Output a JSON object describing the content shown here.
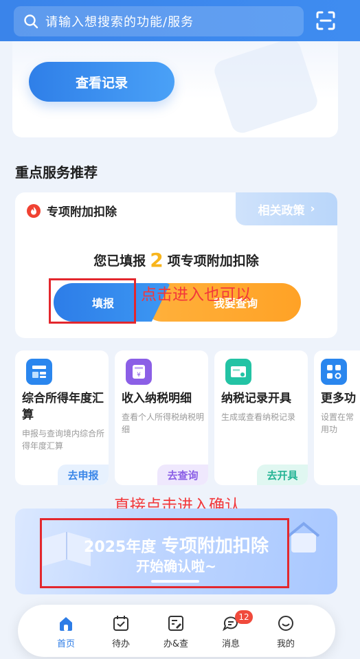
{
  "search": {
    "placeholder": "请输入想搜索的功能/服务"
  },
  "top_card": {
    "record_button": "查看记录"
  },
  "section_title": "重点服务推荐",
  "deduction": {
    "title": "专项附加扣除",
    "policy_button": "相关政策",
    "filled_prefix": "您已填报",
    "filled_count": "2",
    "filled_suffix": "项专项附加扣除",
    "fill_button": "填报",
    "query_button": "我要查询"
  },
  "annotations": {
    "note1": "点击进入也可以",
    "note2": "直接点击进入确认"
  },
  "services": [
    {
      "name": "综合所得年度汇算",
      "desc": "申报与查询境内综合所得年度汇算",
      "action": "去申报",
      "icon": "calculator-icon",
      "color": "#2a86ee",
      "action_bg": "#e7f1fe",
      "action_color": "#3a86e8"
    },
    {
      "name": "收入纳税明细",
      "desc": "查看个人所得税纳税明细",
      "action": "去查询",
      "icon": "document-yen-icon",
      "color": "#8b5fe6",
      "action_bg": "#efe8fd",
      "action_color": "#8b5fe6"
    },
    {
      "name": "纳税记录开具",
      "desc": "生成或查看纳税记录",
      "action": "去开具",
      "icon": "certificate-icon",
      "color": "#23c3a4",
      "action_bg": "#e0f7f1",
      "action_color": "#23b394"
    },
    {
      "name": "更多功",
      "desc": "设置在常用功",
      "icon": "grid-search-icon",
      "color": "#2a86ee"
    }
  ],
  "banner": {
    "year_text": "2025年度",
    "highlight": "专项附加扣除",
    "line2": "开始确认啦~"
  },
  "nav": [
    {
      "label": "首页",
      "icon": "home-icon",
      "active": true
    },
    {
      "label": "待办",
      "icon": "calendar-check-icon"
    },
    {
      "label": "办&查",
      "icon": "edit-doc-icon"
    },
    {
      "label": "消息",
      "icon": "message-icon",
      "badge": "12"
    },
    {
      "label": "我的",
      "icon": "smile-icon"
    }
  ],
  "colors": {
    "primary": "#2d7ce6",
    "accent_orange": "#ffa226",
    "annotation_red": "#e3272d"
  }
}
